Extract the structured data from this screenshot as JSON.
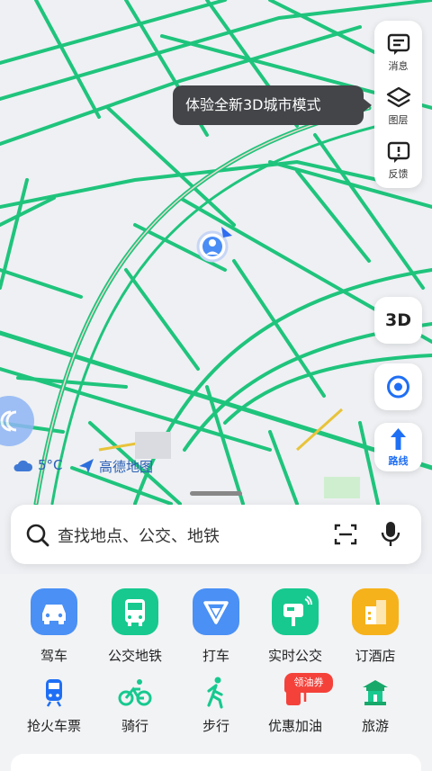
{
  "map": {
    "tooltip": "体验全新3D城市模式",
    "side_buttons": [
      {
        "label": "消息",
        "icon": "message-icon"
      },
      {
        "label": "图层",
        "icon": "layers-icon"
      },
      {
        "label": "反馈",
        "icon": "feedback-icon"
      }
    ],
    "view_3d_label": "3D",
    "route_label": "路线",
    "weather": {
      "temperature": "5°C",
      "icon": "cloud-icon"
    },
    "brand": {
      "name": "高德地图",
      "icon": "amap-logo-icon"
    }
  },
  "search": {
    "placeholder": "查找地点、公交、地铁"
  },
  "services": [
    {
      "label": "驾车",
      "icon": "car-icon",
      "color": "#4a90f5"
    },
    {
      "label": "公交地铁",
      "icon": "bus-icon",
      "color": "#17c98f"
    },
    {
      "label": "打车",
      "icon": "taxi-icon",
      "color": "#4a90f5"
    },
    {
      "label": "实时公交",
      "icon": "bus-stop-icon",
      "color": "#17c98f"
    },
    {
      "label": "订酒店",
      "icon": "hotel-icon",
      "color": "#f6b21b"
    }
  ],
  "shortcuts": [
    {
      "label": "抢火车票",
      "icon": "train-icon"
    },
    {
      "label": "骑行",
      "icon": "bicycle-icon"
    },
    {
      "label": "步行",
      "icon": "walk-icon"
    },
    {
      "label": "优惠加油",
      "icon": "fuel-icon",
      "badge": "领油券"
    },
    {
      "label": "旅游",
      "icon": "travel-icon"
    }
  ],
  "colors": {
    "road": "#1fc47c",
    "accent_blue": "#1f6ff5",
    "green": "#17c98f",
    "orange": "#f6b21b",
    "badge_red": "#f4423b"
  }
}
